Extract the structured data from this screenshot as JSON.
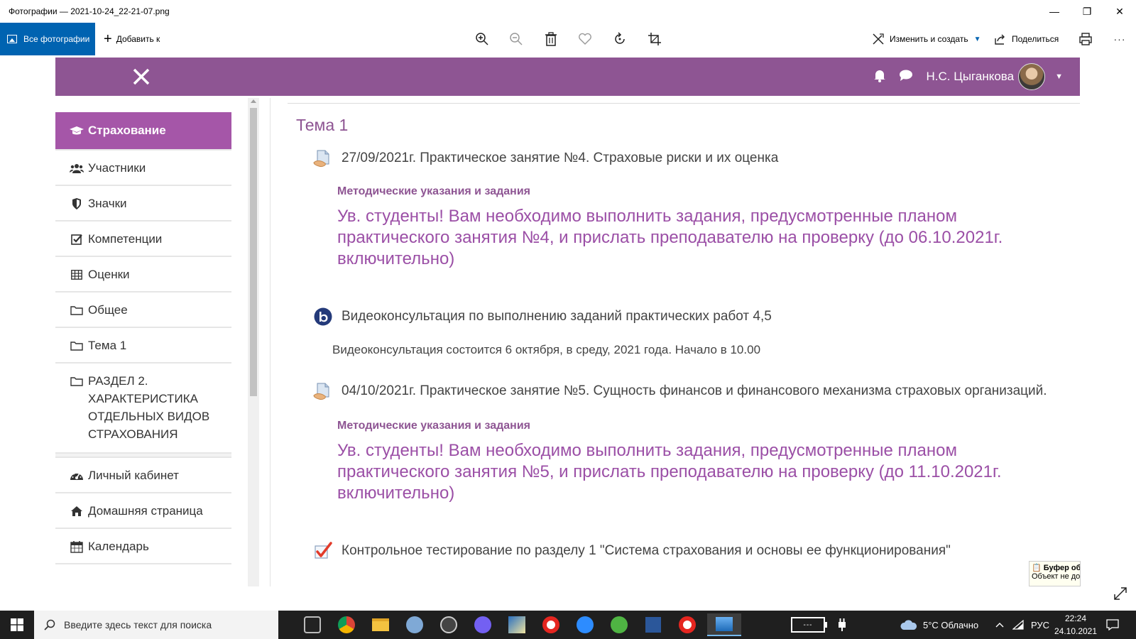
{
  "window": {
    "title": "Фотографии — 2021-10-24_22-21-07.png",
    "minimize": "—",
    "maximize": "❐",
    "close": "✕"
  },
  "toolbar": {
    "all_photos": "Все фотографии",
    "add_to": "Добавить к",
    "edit_create": "Изменить и создать",
    "share": "Поделиться",
    "more": "···",
    "icons": [
      "zoom-in-icon",
      "zoom-out-icon",
      "delete-icon",
      "favorite-icon",
      "rotate-icon",
      "crop-icon",
      "print-icon"
    ]
  },
  "moodle": {
    "user_name": "Н.С. Цыганкова",
    "accent_color": "#8e5593"
  },
  "sidebar": {
    "items": [
      {
        "label": "Страхование",
        "icon": "graduation-cap-icon",
        "active": true
      },
      {
        "label": "Участники",
        "icon": "users-icon"
      },
      {
        "label": "Значки",
        "icon": "shield-icon"
      },
      {
        "label": "Компетенции",
        "icon": "check-square-icon"
      },
      {
        "label": "Оценки",
        "icon": "table-icon"
      },
      {
        "label": "Общее",
        "icon": "folder-icon"
      },
      {
        "label": "Тема 1",
        "icon": "folder-icon"
      },
      {
        "label": "РАЗДЕЛ 2. ХАРАКТЕРИСТИКА ОТДЕЛЬНЫХ ВИДОВ СТРАХОВАНИЯ",
        "icon": "folder-icon"
      }
    ],
    "items2": [
      {
        "label": "Личный кабинет",
        "icon": "dashboard-icon"
      },
      {
        "label": "Домашняя страница",
        "icon": "home-icon"
      },
      {
        "label": "Календарь",
        "icon": "calendar-icon"
      }
    ]
  },
  "main": {
    "section_title": "Тема 1",
    "activities": [
      {
        "title": "27/09/2021г. Практическое занятие №4. Страховые риски и их оценка",
        "label_heading": "Методические указания и задания",
        "label_body": "Ув. студенты! Вам необходимо выполнить задания, предусмотренные планом практического занятия №4, и прислать преподавателю на проверку (до 06.10.2021г. включительно)"
      },
      {
        "title": "Видеоконсультация по выполнению заданий практических работ 4,5",
        "description": "Видеоконсультация состоится 6 октября, в среду, 2021 года. Начало в 10.00"
      },
      {
        "title": "04/10/2021г. Практическое занятие №5. Сущность финансов и финансового механизма страховых организаций.",
        "label_heading": "Методические указания и задания",
        "label_body": "Ув. студенты! Вам необходимо выполнить задания, предусмотренные планом практического занятия №5, и прислать преподавателю на проверку (до 11.10.2021г. включительно)"
      },
      {
        "title": "Контрольное тестирование по разделу 1 \"Система страхования и основы ее функционирования\""
      }
    ]
  },
  "clipboard": {
    "title": "Буфер об",
    "text": "Объект не до"
  },
  "taskbar": {
    "search_placeholder": "Введите здесь текст для поиска",
    "weather": "5°C Облачно",
    "lang": "РУС",
    "time": "22:24",
    "date": "24.10.2021"
  }
}
